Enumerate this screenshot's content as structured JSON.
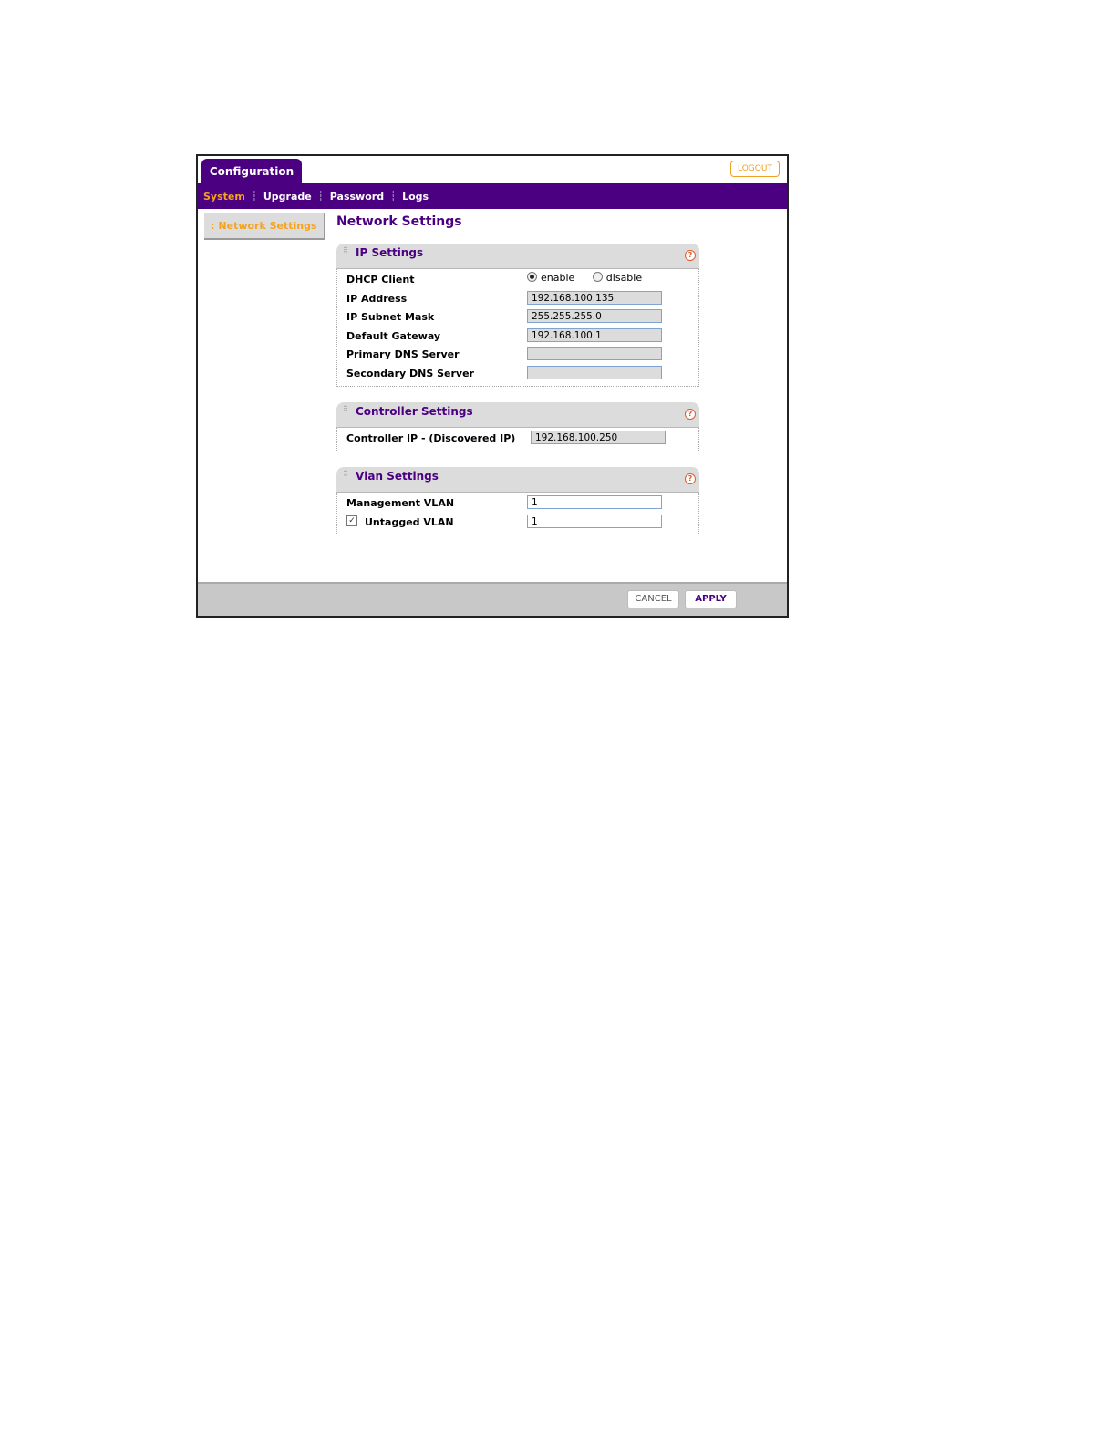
{
  "header": {
    "main_tab": "Configuration",
    "logout": "LOGOUT"
  },
  "subnav": {
    "items": [
      "System",
      "Upgrade",
      "Password",
      "Logs"
    ],
    "active": "System"
  },
  "leftnav": {
    "item": "Network Settings"
  },
  "page_title": "Network Settings",
  "sections": {
    "ip": {
      "title": "IP Settings",
      "dhcp_label": "DHCP Client",
      "dhcp_options": [
        "enable",
        "disable"
      ],
      "dhcp_selected": "enable",
      "ip_address_label": "IP Address",
      "ip_address_value": "192.168.100.135",
      "subnet_label": "IP Subnet Mask",
      "subnet_value": "255.255.255.0",
      "gateway_label": "Default Gateway",
      "gateway_value": "192.168.100.1",
      "primary_dns_label": "Primary DNS Server",
      "primary_dns_value": "",
      "secondary_dns_label": "Secondary DNS Server",
      "secondary_dns_value": ""
    },
    "controller": {
      "title": "Controller Settings",
      "controller_ip_label": "Controller IP - (Discovered IP)",
      "controller_ip_value": "192.168.100.250"
    },
    "vlan": {
      "title": "Vlan Settings",
      "management_label": "Management VLAN",
      "management_value": "1",
      "untagged_label": "Untagged VLAN",
      "untagged_checked": true,
      "untagged_value": "1"
    }
  },
  "footer": {
    "cancel": "CANCEL",
    "apply": "APPLY"
  },
  "colors": {
    "brand": "#4b0082",
    "accent": "#f7a21b",
    "help": "#e05a2a"
  }
}
